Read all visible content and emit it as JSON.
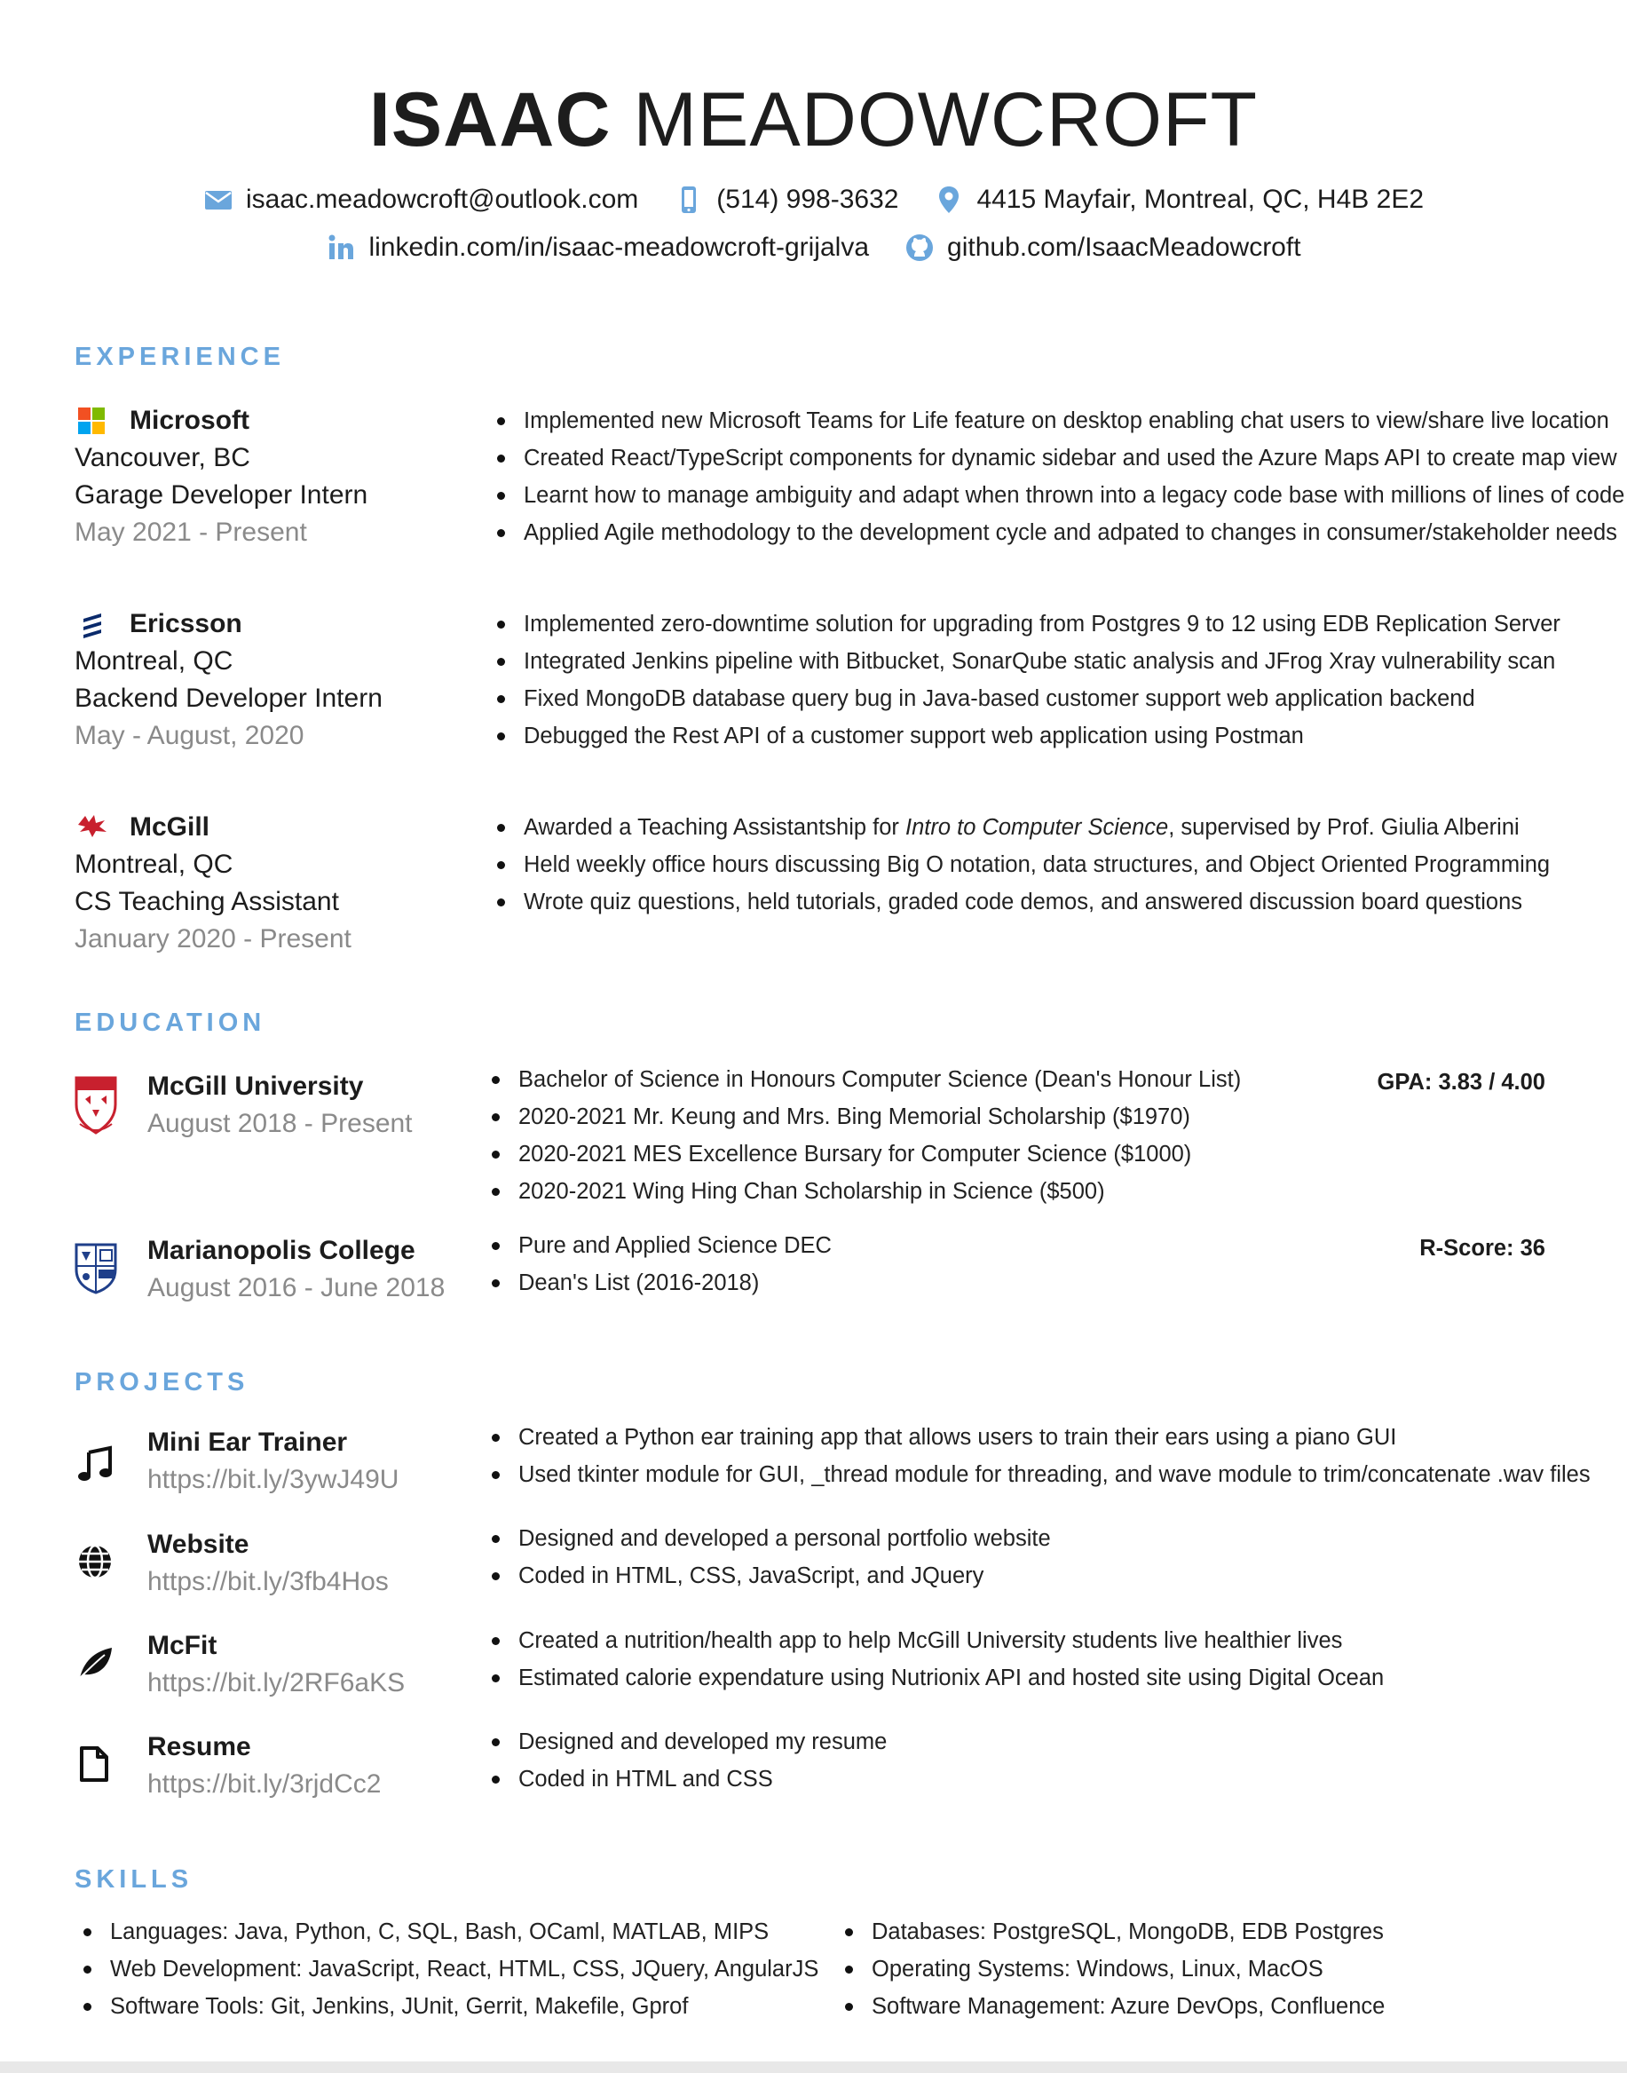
{
  "header": {
    "first_name": "ISAAC",
    "last_name": "MEADOWCROFT",
    "email": "isaac.meadowcroft@outlook.com",
    "phone": "(514) 998-3632",
    "address": "4415 Mayfair, Montreal, QC, H4B 2E2",
    "linkedin": "linkedin.com/in/isaac-meadowcroft-grijalva",
    "github": "github.com/IsaacMeadowcroft"
  },
  "colors": {
    "accent": "#6aa6dc",
    "muted": "#8a8a8a",
    "text": "#1c1c1c"
  },
  "experience": {
    "title": "EXPERIENCE",
    "items": [
      {
        "company": "Microsoft",
        "logo": "microsoft-logo-icon",
        "location": "Vancouver, BC",
        "role": "Garage Developer Intern",
        "dates": "May 2021 - Present",
        "bullets": [
          "Implemented new Microsoft Teams for Life feature on desktop enabling chat users to view/share live location",
          "Created React/TypeScript components for dynamic sidebar and used the Azure Maps API to create map view",
          "Learnt how to manage ambiguity and adapt when thrown into a legacy code base with millions of lines of code",
          "Applied Agile methodology to the development cycle and adpated to changes in consumer/stakeholder needs"
        ]
      },
      {
        "company": "Ericsson",
        "logo": "ericsson-logo-icon",
        "location": "Montreal, QC",
        "role": "Backend Developer Intern",
        "dates": "May - August, 2020",
        "bullets": [
          "Implemented zero-downtime solution for upgrading from Postgres 9 to 12 using EDB Replication Server",
          "Integrated Jenkins pipeline with Bitbucket, SonarQube static analysis and JFrog Xray vulnerability scan",
          "Fixed MongoDB database query bug in Java-based customer support web application backend",
          "Debugged the Rest API of a customer support web application using Postman"
        ]
      },
      {
        "company": "McGill",
        "logo": "mcgill-bird-logo-icon",
        "location": "Montreal, QC",
        "role": "CS Teaching Assistant",
        "dates": "January 2020 - Present",
        "bullet0_pre": "Awarded a Teaching Assistantship for ",
        "bullet0_em": "Intro to Computer Science",
        "bullet0_post": ", supervised by Prof. Giulia Alberini",
        "bullets": [
          "Held weekly office hours discussing Big O notation, data structures, and Object Oriented Programming",
          "Wrote quiz questions, held tutorials, graded code demos, and answered discussion board questions"
        ]
      }
    ]
  },
  "education": {
    "title": "EDUCATION",
    "items": [
      {
        "school": "McGill University",
        "logo": "mcgill-crest-icon",
        "dates": "August 2018 - Present",
        "note": "GPA: 3.83 / 4.00",
        "bullets": [
          "Bachelor of Science in Honours Computer Science (Dean's Honour List)",
          "2020-2021 Mr. Keung and Mrs. Bing Memorial Scholarship ($1970)",
          "2020-2021 MES Excellence Bursary for Computer Science ($1000)",
          "2020-2021 Wing Hing Chan Scholarship in Science ($500)"
        ]
      },
      {
        "school": "Marianopolis College",
        "logo": "marianopolis-crest-icon",
        "dates": "August 2016 - June 2018",
        "note": "R-Score: 36",
        "bullets": [
          "Pure and Applied Science DEC",
          "Dean's List (2016-2018)"
        ]
      }
    ]
  },
  "projects": {
    "title": "PROJECTS",
    "items": [
      {
        "name": "Mini Ear Trainer",
        "url": "https://bit.ly/3ywJ49U",
        "icon": "music-note-icon",
        "bullets": [
          "Created a Python ear training app that allows users to train their ears using a piano GUI",
          "Used tkinter module for GUI, _thread module for threading, and wave module to trim/concatenate .wav files"
        ]
      },
      {
        "name": "Website",
        "url": "https://bit.ly/3fb4Hos",
        "icon": "globe-icon",
        "bullets": [
          "Designed and developed a personal portfolio website",
          "Coded in HTML, CSS, JavaScript, and JQuery"
        ]
      },
      {
        "name": "McFit",
        "url": "https://bit.ly/2RF6aKS",
        "icon": "leaf-icon",
        "bullets": [
          "Created a nutrition/health app to help McGill University students live healthier lives",
          "Estimated calorie expendature using Nutrionix API and hosted site using Digital Ocean"
        ]
      },
      {
        "name": "Resume",
        "url": "https://bit.ly/3rjdCc2",
        "icon": "document-icon",
        "bullets": [
          "Designed and developed my resume",
          "Coded in HTML and CSS"
        ]
      }
    ]
  },
  "skills": {
    "title": "SKILLS",
    "left": [
      "Languages: Java, Python, C, SQL, Bash, OCaml, MATLAB, MIPS",
      "Web Development: JavaScript, React, HTML, CSS, JQuery, AngularJS",
      "Software Tools: Git, Jenkins, JUnit, Gerrit, Makefile, Gprof"
    ],
    "right": [
      "Databases: PostgreSQL, MongoDB, EDB Postgres",
      "Operating Systems: Windows, Linux, MacOS",
      "Software Management: Azure DevOps, Confluence"
    ]
  }
}
